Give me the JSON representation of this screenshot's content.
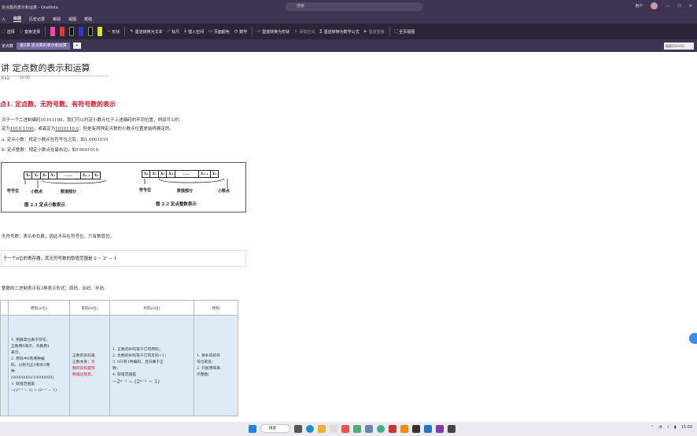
{
  "window": {
    "title": "定点数的表示和运算 - OneNote",
    "search_placeholder": "搜索",
    "user": "用户"
  },
  "menu": [
    "入",
    "绘图",
    "历史记录",
    "审阅",
    "视图",
    "帮助"
  ],
  "ribbon": {
    "select": "选择",
    "lasso": "套索选择",
    "eraser": "橡皮擦",
    "shapes": "形状",
    "ruler": "标尺",
    "math": "数学",
    "ink_to_text": "墨迹转换为文本",
    "ink_to_shape": "墨迹转换为形状",
    "ink_to_math": "墨迹转换为数学公式",
    "replay": "墨迹重播",
    "page_color": "页面颜色",
    "insert_space": "插入空间",
    "add_space": "添加空间",
    "full_page": "全页视图"
  },
  "tabs": {
    "section": "定点数",
    "page": "第2章 定点数的表示和运算",
    "search": "搜索(Ctrl+E)"
  },
  "page": {
    "title": "讲 定点数的表示和运算",
    "date": "月9日",
    "time": "15:00"
  },
  "section_heading": "点1. 定点数、无符号数、有符号数的表示",
  "para1a": "对于一个二进制编码10101100，我们可以约定小数点位于上述编码的不同位置，例如可以约",
  "para1b_prefix": "定为",
  "para1b_u1": "1010.1100",
  "para1b_mid": "，或者定为",
  "para1b_u2": "1010110.0",
  "para1b_suffix": "；但是有两种定点数的小数点位置是始终确定的。",
  "item_a": "a. 定点小数：规定小数点在符号位之后，如1.0001010",
  "item_b": "b. 定点整数：规定小数点在最右边，如10001010.",
  "figure": {
    "left_bits": [
      "X₀",
      "X₁",
      "X₂",
      "X₃",
      "……",
      "Xₙ₋₁",
      "Xₙ"
    ],
    "right_bits": [
      "X₀",
      "X₁",
      "X₂",
      "X₃",
      "……",
      "Xₙ₋₁",
      "Xₙ"
    ],
    "left_labels": [
      "符号位",
      "小数点",
      "数值部分"
    ],
    "right_labels": [
      "符号位",
      "数值部分",
      "小数点"
    ],
    "cap_left": "图 2.1   定点小数表示",
    "cap_right": "图 2.2   定点整数表示"
  },
  "unsigned_note": "无符号数：表示非负数，因此不存在符号位，只有数值位。",
  "range_box": "于一个n位的寄存器，其无符号数的取值范围是 0 ~ 2ⁿ − 1",
  "signed_note": "整数的二进制表示有3种表示形式：原码、反码、补码",
  "table": {
    "headers": [
      "",
      "原码(n位)",
      "反码(n位)",
      "补码(n位)",
      "移码"
    ],
    "col1": [
      "1. 用最高位表示符号，",
      "正数用0表示，负数用1",
      "表示。",
      "2. 原码中0有两种编",
      "码，分别为正0和负0两",
      "种",
      "(00000000/10000000)",
      "3. 取值范围是",
      "−(2ⁿ⁻¹ − 1) ~ (2ⁿ⁻¹ − 1)"
    ],
    "col2a": "正数的反码是",
    "col2b": "正数本身；",
    "col2c": "负",
    "col2d": "数的反码是符",
    "col2e": "数值位取反。",
    "col3": [
      "1. 正数的补码等于它的原码；",
      "2. 负数的补码等于它的反码+1；",
      "3. 0只有1种编码，且归属于正",
      "数；",
      "4. 取值范围是",
      "−2ⁿ⁻¹ ~ (2ⁿ⁻¹ − 1)"
    ],
    "col4": [
      "1. 将补码的符",
      "号位取反；",
      "2. 只能用来表",
      "示整数；"
    ]
  },
  "taskbar": {
    "search": "搜索",
    "time": "15:00"
  }
}
